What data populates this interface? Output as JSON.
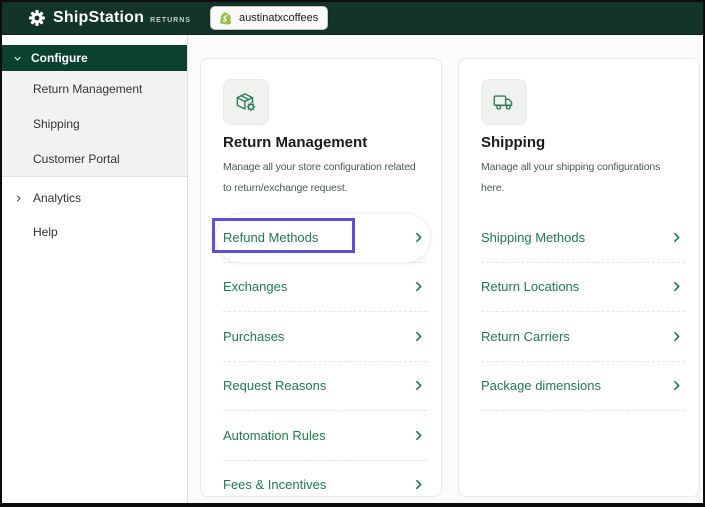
{
  "header": {
    "brand": "ShipStation",
    "brand_suffix": "RETURNS",
    "store_name": "austinatxcoffees"
  },
  "sidebar": {
    "configure_label": "Configure",
    "sub_items": [
      {
        "label": "Return Management"
      },
      {
        "label": "Shipping"
      },
      {
        "label": "Customer Portal"
      }
    ],
    "analytics_label": "Analytics",
    "help_label": "Help"
  },
  "cards": [
    {
      "icon": "package-gear-icon",
      "title": "Return Management",
      "description": "Manage all your store configuration related\nto return/exchange request.",
      "links": [
        {
          "label": "Refund Methods",
          "highlighted": true
        },
        {
          "label": "Exchanges"
        },
        {
          "label": "Purchases"
        },
        {
          "label": "Request Reasons"
        },
        {
          "label": "Automation Rules"
        },
        {
          "label": "Fees & Incentives"
        }
      ]
    },
    {
      "icon": "truck-icon",
      "title": "Shipping",
      "description": "Manage all your shipping configurations\nhere.",
      "links": [
        {
          "label": "Shipping Methods"
        },
        {
          "label": "Return Locations"
        },
        {
          "label": "Return Carriers"
        },
        {
          "label": "Package dimensions"
        }
      ]
    }
  ],
  "colors": {
    "header_bg": "#12342a",
    "selected_nav_bg": "#0b4131",
    "link_green": "#1e7b52",
    "annotation_purple": "#5b50e0",
    "shopify_green": "#96BF48"
  }
}
